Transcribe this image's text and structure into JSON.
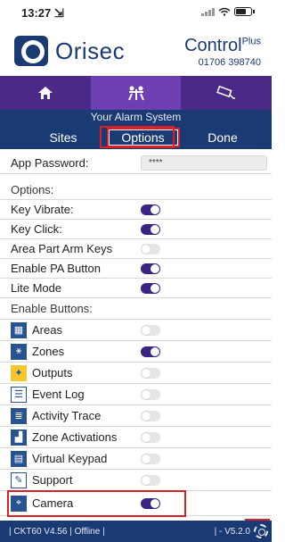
{
  "status": {
    "time": "13:27 ⇲"
  },
  "brand": {
    "name": "Orisec",
    "control_title": "Control",
    "control_sup": "Plus",
    "phone": "01706 398740"
  },
  "system_bar": "Your Alarm System",
  "buttons": {
    "sites": "Sites",
    "options": "Options",
    "done": "Done"
  },
  "app_password": {
    "label": "App Password:",
    "value": "****"
  },
  "options": {
    "header": "Options:",
    "items": [
      {
        "label": "Key Vibrate:",
        "on": true
      },
      {
        "label": "Key Click:",
        "on": true
      },
      {
        "label": "Area Part Arm Keys",
        "on": false
      },
      {
        "label": "Enable PA Button",
        "on": true
      },
      {
        "label": "Lite Mode",
        "on": true
      }
    ]
  },
  "enable_buttons": {
    "header": "Enable Buttons:",
    "items": [
      {
        "label": "Areas",
        "icon": "areas-icon",
        "on": false
      },
      {
        "label": "Zones",
        "icon": "zones-icon",
        "on": true
      },
      {
        "label": "Outputs",
        "icon": "outputs-icon",
        "on": false
      },
      {
        "label": "Event Log",
        "icon": "event-log-icon",
        "on": false
      },
      {
        "label": "Activity Trace",
        "icon": "activity-trace-icon",
        "on": false
      },
      {
        "label": "Zone Activations",
        "icon": "zone-activations-icon",
        "on": false
      },
      {
        "label": "Virtual Keypad",
        "icon": "virtual-keypad-icon",
        "on": false
      },
      {
        "label": "Support",
        "icon": "support-icon",
        "on": false
      },
      {
        "label": "Camera",
        "icon": "camera-icon",
        "on": true
      }
    ]
  },
  "footer": {
    "left": "| CKT60 V4.56 | Offline |",
    "right": "| - V5.2.0"
  },
  "colors": {
    "primary": "#1a3a73",
    "nav": "#4a2a86",
    "toggle_on": "#3a2383",
    "highlight": "#d92026"
  }
}
